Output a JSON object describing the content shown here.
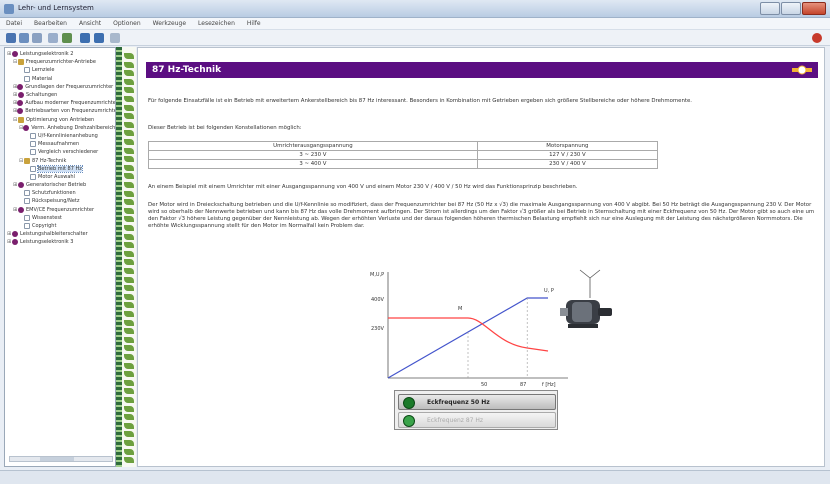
{
  "window": {
    "title": "Lehr- und Lernsystem"
  },
  "menu": [
    "Datei",
    "Bearbeiten",
    "Ansicht",
    "Optionen",
    "Werkzeuge",
    "Lesezeichen",
    "Hilfe"
  ],
  "sidebar": {
    "items": [
      {
        "exp": "⊞",
        "icon": "book",
        "label": "Leistungselektronik 2"
      },
      {
        "exp": "⊟",
        "icon": "folder",
        "label": "Frequenzumrichter-Antriebe"
      },
      {
        "exp": "",
        "icon": "page",
        "label": "Lernziele"
      },
      {
        "exp": "",
        "icon": "page",
        "label": "Material"
      },
      {
        "exp": "⊞",
        "icon": "book",
        "label": "Grundlagen der Frequenzumrichter"
      },
      {
        "exp": "⊞",
        "icon": "book",
        "label": "Schaltungen"
      },
      {
        "exp": "⊞",
        "icon": "book",
        "label": "Aufbau moderner Frequenzumrichter"
      },
      {
        "exp": "⊞",
        "icon": "book",
        "label": "Betriebsarten von Frequenzumrichtern"
      },
      {
        "exp": "⊟",
        "icon": "folder",
        "label": "Optimierung von Antrieben"
      },
      {
        "exp": "⊟",
        "icon": "book",
        "label": "Verm. Anhebung Drehzahlbereich"
      },
      {
        "exp": "",
        "icon": "page",
        "label": "U/f-Kennlinienanhebung"
      },
      {
        "exp": "",
        "icon": "page",
        "label": "Messaufnahmen"
      },
      {
        "exp": "",
        "icon": "page",
        "label": "Vergleich verschiedener"
      },
      {
        "exp": "⊟",
        "icon": "folder",
        "label": "87 Hz-Technik"
      },
      {
        "exp": "",
        "icon": "page",
        "label": "Betrieb mit 87 Hz"
      },
      {
        "exp": "",
        "icon": "page",
        "label": "Motor Auswahl"
      },
      {
        "exp": "⊞",
        "icon": "book",
        "label": "Generatorischer Betrieb"
      },
      {
        "exp": "",
        "icon": "page",
        "label": "Schutzfunktionen"
      },
      {
        "exp": "",
        "icon": "page",
        "label": "Rückspeisung/Netz"
      },
      {
        "exp": "⊞",
        "icon": "book",
        "label": "EMV/CE Frequenzumrichter"
      },
      {
        "exp": "",
        "icon": "page",
        "label": "Wissenstest"
      },
      {
        "exp": "",
        "icon": "page",
        "label": "Copyright"
      },
      {
        "exp": "⊞",
        "icon": "book",
        "label": "Leistungshalbleiterschalter"
      },
      {
        "exp": "⊞",
        "icon": "book",
        "label": "Leistungselektronik 3"
      }
    ],
    "selected_index": 14
  },
  "content": {
    "header_title": "87 Hz-Technik",
    "para1": "Für folgende Einsatzfälle ist ein Betrieb mit erweitertem Ankerstellbereich bis 87 Hz interessant. Besonders in Kombination mit Getrieben ergeben sich größere Stellbereiche oder höhere Drehmomente.",
    "para2": "Dieser Betrieb ist bei folgenden Konstellationen möglich:",
    "table": {
      "headers": [
        "Umrichterausgangsspannung",
        "Motorspannung"
      ],
      "rows": [
        [
          "3 ~ 230 V",
          "127 V / 230 V"
        ],
        [
          "3 ~ 400 V",
          "230 V / 400 V"
        ]
      ]
    },
    "para3": "An einem Beispiel mit einem Umrichter mit einer Ausgangsspannung von 400 V und einem Motor 230 V / 400 V / 50 Hz wird das Funktionsprinzip beschrieben.",
    "para4": "Der Motor wird in Dreieckschaltung betrieben und die U/f-Kennlinie so modifiziert, dass der Frequenzumrichter bei 87 Hz (50 Hz x √3) die maximale Ausgangsspannung von 400 V abgibt. Bei 50 Hz beträgt die Ausgangsspannung 230 V. Der Motor wird so oberhalb der Nennwerte betrieben und kann bis 87 Hz das volle Drehmoment aufbringen. Der Strom ist allerdings um den Faktor √3 größer als bei Betrieb in Sternschaltung mit einer Eckfrequenz von 50 Hz. Der Motor gibt so auch eine um den Faktor √3 höhere Leistung gegenüber der Nennleistung ab. Wegen der erhöhten Verluste und der daraus folgenden höheren thermischen Belastung empfiehlt sich nur eine Auslegung mit der Leistung des nächstgrößeren Normmotors. Die erhöhte Wicklungsspannung stellt für den Motor im Normalfall kein Problem dar."
  },
  "chart": {
    "ylabel": "M,U,P",
    "xlabel": "f [Hz]",
    "ytick_400": "400V",
    "ytick_230": "230V",
    "xtick_50": "50",
    "xtick_87": "87",
    "label_M": "M",
    "label_UP": "U, P"
  },
  "chart_data": {
    "type": "line",
    "xlabel": "f [Hz]",
    "ylabel": "M,U,P",
    "x_ticks": [
      "50",
      "87"
    ],
    "y_ticks": [
      "230V",
      "400V"
    ],
    "series": [
      {
        "name": "U, P",
        "color": "#4455cc",
        "x": [
          0,
          87,
          100
        ],
        "y": [
          0,
          400,
          400
        ]
      },
      {
        "name": "M",
        "color": "#ff4444",
        "x": [
          0,
          50,
          87,
          100
        ],
        "y": [
          300,
          300,
          150,
          135
        ]
      }
    ]
  },
  "buttons": [
    {
      "label": "Eckfrequenz 50 Hz",
      "active": true
    },
    {
      "label": "Eckfrequenz 87 Hz",
      "active": false
    }
  ],
  "colors": {
    "accent": "#5b0e82",
    "u_line": "#4455cc",
    "m_line": "#ff4444"
  }
}
